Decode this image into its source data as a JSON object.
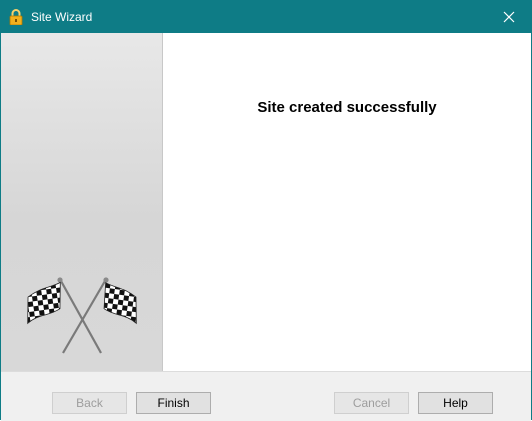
{
  "window": {
    "title": "Site Wizard",
    "close_glyph": "✕",
    "icon": "padlock-icon"
  },
  "sidebar": {
    "image": "checkered-flags-icon"
  },
  "content": {
    "heading": "Site created successfully"
  },
  "footer": {
    "back_label": "Back",
    "finish_label": "Finish",
    "cancel_label": "Cancel",
    "help_label": "Help"
  },
  "colors": {
    "titlebar": "#0e7c86",
    "accent_lock": "#f2b01e"
  }
}
